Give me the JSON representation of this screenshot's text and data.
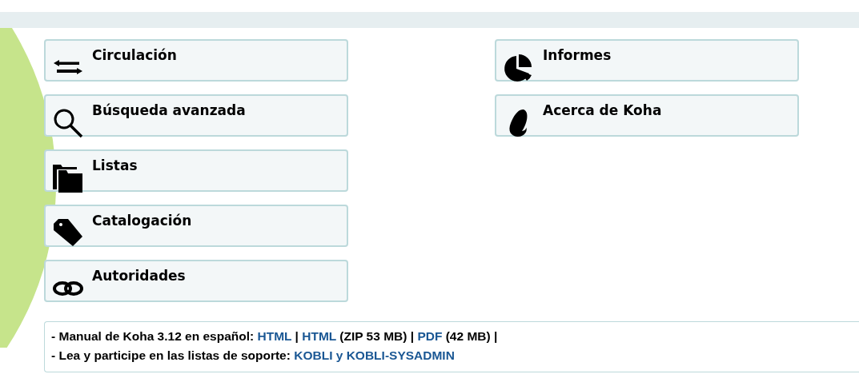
{
  "modules_left": [
    {
      "kind": "circulation",
      "label": "Circulación"
    },
    {
      "kind": "search",
      "label": "Búsqueda avanzada"
    },
    {
      "kind": "lists",
      "label": "Listas"
    },
    {
      "kind": "cataloging",
      "label": "Catalogación"
    },
    {
      "kind": "authorities",
      "label": "Autoridades"
    }
  ],
  "modules_right": [
    {
      "kind": "reports",
      "label": "Informes"
    },
    {
      "kind": "about",
      "label": "Acerca de Koha"
    }
  ],
  "footer": [
    [
      {
        "kind": "text",
        "text": "- Manual de Koha 3.12 en español: "
      },
      {
        "kind": "link",
        "text": "HTML"
      },
      {
        "kind": "text",
        "text": " | "
      },
      {
        "kind": "link",
        "text": "HTML"
      },
      {
        "kind": "text",
        "text": " (ZIP 53 MB) | "
      },
      {
        "kind": "link",
        "text": "PDF"
      },
      {
        "kind": "text",
        "text": " (42 MB) |"
      }
    ],
    [
      {
        "kind": "text",
        "text": "- Lea y participe en las listas de soporte: "
      },
      {
        "kind": "link",
        "text": "KOBLI y KOBLI-SYSADMIN"
      }
    ]
  ]
}
